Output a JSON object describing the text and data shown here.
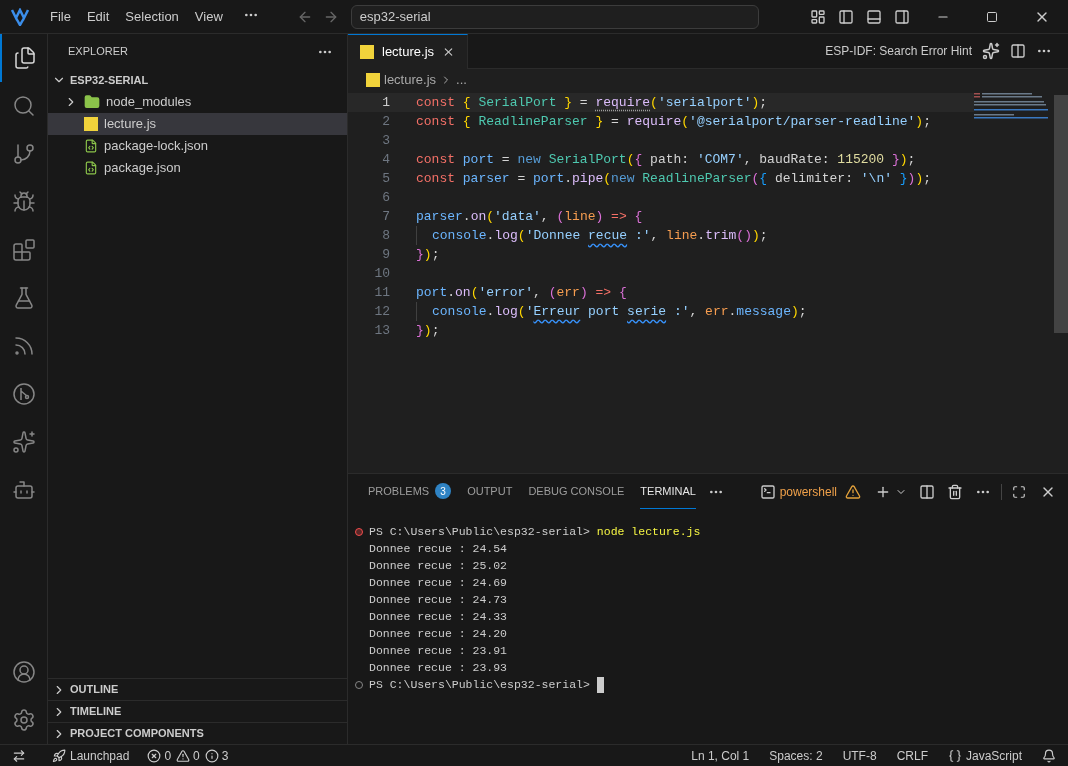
{
  "titlebar": {
    "menu": [
      "File",
      "Edit",
      "Selection",
      "View"
    ],
    "search": "esp32-serial"
  },
  "activity_bar": {
    "items": [
      {
        "kind": "files",
        "selected": true
      },
      {
        "kind": "search",
        "selected": false
      },
      {
        "kind": "source",
        "selected": false
      },
      {
        "kind": "debug",
        "selected": false
      },
      {
        "kind": "extensions",
        "selected": false
      },
      {
        "kind": "testing",
        "selected": false
      },
      {
        "kind": "espressif",
        "selected": false
      },
      {
        "kind": "gitgraph",
        "selected": false
      },
      {
        "kind": "ai",
        "selected": false
      },
      {
        "kind": "alien",
        "selected": false
      }
    ]
  },
  "sidebar": {
    "title": "EXPLORER",
    "root": {
      "label": "ESP32-SERIAL",
      "expanded": true,
      "children": [
        {
          "label": "node_modules",
          "kind": "folder",
          "expanded": false,
          "selected": false
        },
        {
          "label": "lecture.js",
          "kind": "js",
          "selected": true
        },
        {
          "label": "package-lock.json",
          "kind": "json",
          "selected": false
        },
        {
          "label": "package.json",
          "kind": "json",
          "selected": false
        }
      ]
    },
    "sections": [
      {
        "label": "OUTLINE",
        "expanded": false
      },
      {
        "label": "TIMELINE",
        "expanded": false
      },
      {
        "label": "PROJECT COMPONENTS",
        "expanded": false
      }
    ]
  },
  "editor": {
    "tabs": [
      {
        "label": "lecture.js",
        "selected": true
      }
    ],
    "action_text": "ESP-IDF: Search Error Hint",
    "breadcrumb": [
      "lecture.js",
      "..."
    ],
    "lines": [
      {
        "n": "1",
        "current": true,
        "tokens": [
          {
            "text": "const ",
            "kind": "kw"
          },
          {
            "text": "{",
            "kind": "brace"
          },
          {
            "text": " SerialPort ",
            "kind": "cls"
          },
          {
            "text": "}",
            "kind": "brace"
          },
          {
            "text": " = ",
            "kind": "plain"
          },
          {
            "text": "require",
            "kind": "fn",
            "hint": true
          },
          {
            "text": "(",
            "kind": "brace"
          },
          {
            "text": "'serialport'",
            "kind": "str"
          },
          {
            "text": ")",
            "kind": "brace"
          },
          {
            "text": ";",
            "kind": "plain"
          }
        ]
      },
      {
        "n": "2",
        "current": false,
        "tokens": [
          {
            "text": "const ",
            "kind": "kw"
          },
          {
            "text": "{",
            "kind": "brace"
          },
          {
            "text": " ReadlineParser ",
            "kind": "cls"
          },
          {
            "text": "}",
            "kind": "brace"
          },
          {
            "text": " = ",
            "kind": "plain"
          },
          {
            "text": "require",
            "kind": "fn"
          },
          {
            "text": "(",
            "kind": "brace"
          },
          {
            "text": "'@serialport/parser-readline'",
            "kind": "str"
          },
          {
            "text": ")",
            "kind": "brace"
          },
          {
            "text": ";",
            "kind": "plain"
          }
        ]
      },
      {
        "n": "3",
        "current": false
      },
      {
        "n": "4",
        "current": false,
        "tokens": [
          {
            "text": "const ",
            "kind": "kw"
          },
          {
            "text": "port",
            "kind": "var"
          },
          {
            "text": " = ",
            "kind": "plain"
          },
          {
            "text": "new ",
            "kind": "kw2"
          },
          {
            "text": "SerialPort",
            "kind": "cls"
          },
          {
            "text": "(",
            "kind": "brace"
          },
          {
            "text": "{",
            "kind": "brace2"
          },
          {
            "text": " path: ",
            "kind": "plain"
          },
          {
            "text": "'COM7'",
            "kind": "str"
          },
          {
            "text": ", baudRate: ",
            "kind": "plain"
          },
          {
            "text": "115200 ",
            "kind": "num"
          },
          {
            "text": "}",
            "kind": "brace2"
          },
          {
            "text": ")",
            "kind": "brace"
          },
          {
            "text": ";",
            "kind": "plain"
          }
        ]
      },
      {
        "n": "5",
        "current": false,
        "tokens": [
          {
            "text": "const ",
            "kind": "kw"
          },
          {
            "text": "parser",
            "kind": "var"
          },
          {
            "text": " = ",
            "kind": "plain"
          },
          {
            "text": "port",
            "kind": "var"
          },
          {
            "text": ".",
            "kind": "plain"
          },
          {
            "text": "pipe",
            "kind": "fn"
          },
          {
            "text": "(",
            "kind": "brace"
          },
          {
            "text": "new ",
            "kind": "kw2"
          },
          {
            "text": "ReadlineParser",
            "kind": "cls"
          },
          {
            "text": "(",
            "kind": "brace2"
          },
          {
            "text": "{",
            "kind": "brace3"
          },
          {
            "text": " delimiter: ",
            "kind": "plain"
          },
          {
            "text": "'\\n' ",
            "kind": "str"
          },
          {
            "text": "}",
            "kind": "brace3"
          },
          {
            "text": ")",
            "kind": "brace2"
          },
          {
            "text": ")",
            "kind": "brace"
          },
          {
            "text": ";",
            "kind": "plain"
          }
        ]
      },
      {
        "n": "6",
        "current": false
      },
      {
        "n": "7",
        "current": false,
        "tokens": [
          {
            "text": "parser",
            "kind": "var"
          },
          {
            "text": ".",
            "kind": "plain"
          },
          {
            "text": "on",
            "kind": "fn"
          },
          {
            "text": "(",
            "kind": "brace"
          },
          {
            "text": "'data'",
            "kind": "str"
          },
          {
            "text": ", ",
            "kind": "plain"
          },
          {
            "text": "(",
            "kind": "brace2"
          },
          {
            "text": "line",
            "kind": "param"
          },
          {
            "text": ") ",
            "kind": "brace2"
          },
          {
            "text": "=> ",
            "kind": "kw"
          },
          {
            "text": "{",
            "kind": "brace2"
          }
        ]
      },
      {
        "n": "8",
        "current": false,
        "indent": true,
        "tokens": [
          {
            "text": "console",
            "kind": "var"
          },
          {
            "text": ".",
            "kind": "plain"
          },
          {
            "text": "log",
            "kind": "fn"
          },
          {
            "text": "(",
            "kind": "brace"
          },
          {
            "text": "'Donnee ",
            "kind": "str"
          },
          {
            "text": "recue",
            "kind": "str",
            "misspelled": true
          },
          {
            "text": " :'",
            "kind": "str"
          },
          {
            "text": ", ",
            "kind": "plain"
          },
          {
            "text": "line",
            "kind": "param"
          },
          {
            "text": ".",
            "kind": "plain"
          },
          {
            "text": "trim",
            "kind": "fn"
          },
          {
            "text": "()",
            "kind": "brace2"
          },
          {
            "text": ")",
            "kind": "brace"
          },
          {
            "text": ";",
            "kind": "plain"
          }
        ]
      },
      {
        "n": "9",
        "current": false,
        "tokens": [
          {
            "text": "}",
            "kind": "brace2"
          },
          {
            "text": ")",
            "kind": "brace"
          },
          {
            "text": ";",
            "kind": "plain"
          }
        ]
      },
      {
        "n": "10",
        "current": false
      },
      {
        "n": "11",
        "current": false,
        "tokens": [
          {
            "text": "port",
            "kind": "var"
          },
          {
            "text": ".",
            "kind": "plain"
          },
          {
            "text": "on",
            "kind": "fn"
          },
          {
            "text": "(",
            "kind": "brace"
          },
          {
            "text": "'error'",
            "kind": "str"
          },
          {
            "text": ", ",
            "kind": "plain"
          },
          {
            "text": "(",
            "kind": "brace2"
          },
          {
            "text": "err",
            "kind": "param"
          },
          {
            "text": ") ",
            "kind": "brace2"
          },
          {
            "text": "=> ",
            "kind": "kw"
          },
          {
            "text": "{",
            "kind": "brace2"
          }
        ]
      },
      {
        "n": "12",
        "current": false,
        "indent": true,
        "tokens": [
          {
            "text": "console",
            "kind": "var"
          },
          {
            "text": ".",
            "kind": "plain"
          },
          {
            "text": "log",
            "kind": "fn"
          },
          {
            "text": "(",
            "kind": "brace"
          },
          {
            "text": "'",
            "kind": "str"
          },
          {
            "text": "Erreur",
            "kind": "str",
            "misspelled": true
          },
          {
            "text": " port ",
            "kind": "str"
          },
          {
            "text": "serie",
            "kind": "str",
            "misspelled": true
          },
          {
            "text": " :'",
            "kind": "str"
          },
          {
            "text": ", ",
            "kind": "plain"
          },
          {
            "text": "err",
            "kind": "param"
          },
          {
            "text": ".",
            "kind": "plain"
          },
          {
            "text": "message",
            "kind": "var"
          },
          {
            "text": ")",
            "kind": "brace"
          },
          {
            "text": ";",
            "kind": "plain"
          }
        ]
      },
      {
        "n": "13",
        "current": false,
        "tokens": [
          {
            "text": "}",
            "kind": "brace2"
          },
          {
            "text": ")",
            "kind": "brace"
          },
          {
            "text": ";",
            "kind": "plain"
          }
        ]
      }
    ]
  },
  "panel": {
    "tabs": [
      {
        "label": "PROBLEMS",
        "badge": "3",
        "selected": false
      },
      {
        "label": "OUTPUT",
        "selected": false
      },
      {
        "label": "DEBUG CONSOLE",
        "selected": false
      },
      {
        "label": "TERMINAL",
        "selected": true
      }
    ],
    "shell": "powershell",
    "terminal": [
      {
        "kind": "prompt",
        "failed": true,
        "prompt": "PS C:\\Users\\Public\\esp32-serial>",
        "command": "node lecture.js",
        "cursor": false
      },
      {
        "kind": "output",
        "text": "Donnee recue : 24.54"
      },
      {
        "kind": "output",
        "text": "Donnee recue : 25.02"
      },
      {
        "kind": "output",
        "text": "Donnee recue : 24.69"
      },
      {
        "kind": "output",
        "text": "Donnee recue : 24.73"
      },
      {
        "kind": "output",
        "text": "Donnee recue : 24.33"
      },
      {
        "kind": "output",
        "text": "Donnee recue : 24.20"
      },
      {
        "kind": "output",
        "text": "Donnee recue : 23.91"
      },
      {
        "kind": "output",
        "text": "Donnee recue : 23.93"
      },
      {
        "kind": "prompt",
        "failed": false,
        "prompt": "PS C:\\Users\\Public\\esp32-serial>",
        "cursor": true
      }
    ]
  },
  "status_bar": {
    "launchpad": "Launchpad",
    "errors": "0",
    "warnings": "0",
    "infos": "3",
    "right": [
      "Ln 1, Col 1",
      "Spaces: 2",
      "UTF-8",
      "CRLF"
    ],
    "language": "JavaScript"
  }
}
